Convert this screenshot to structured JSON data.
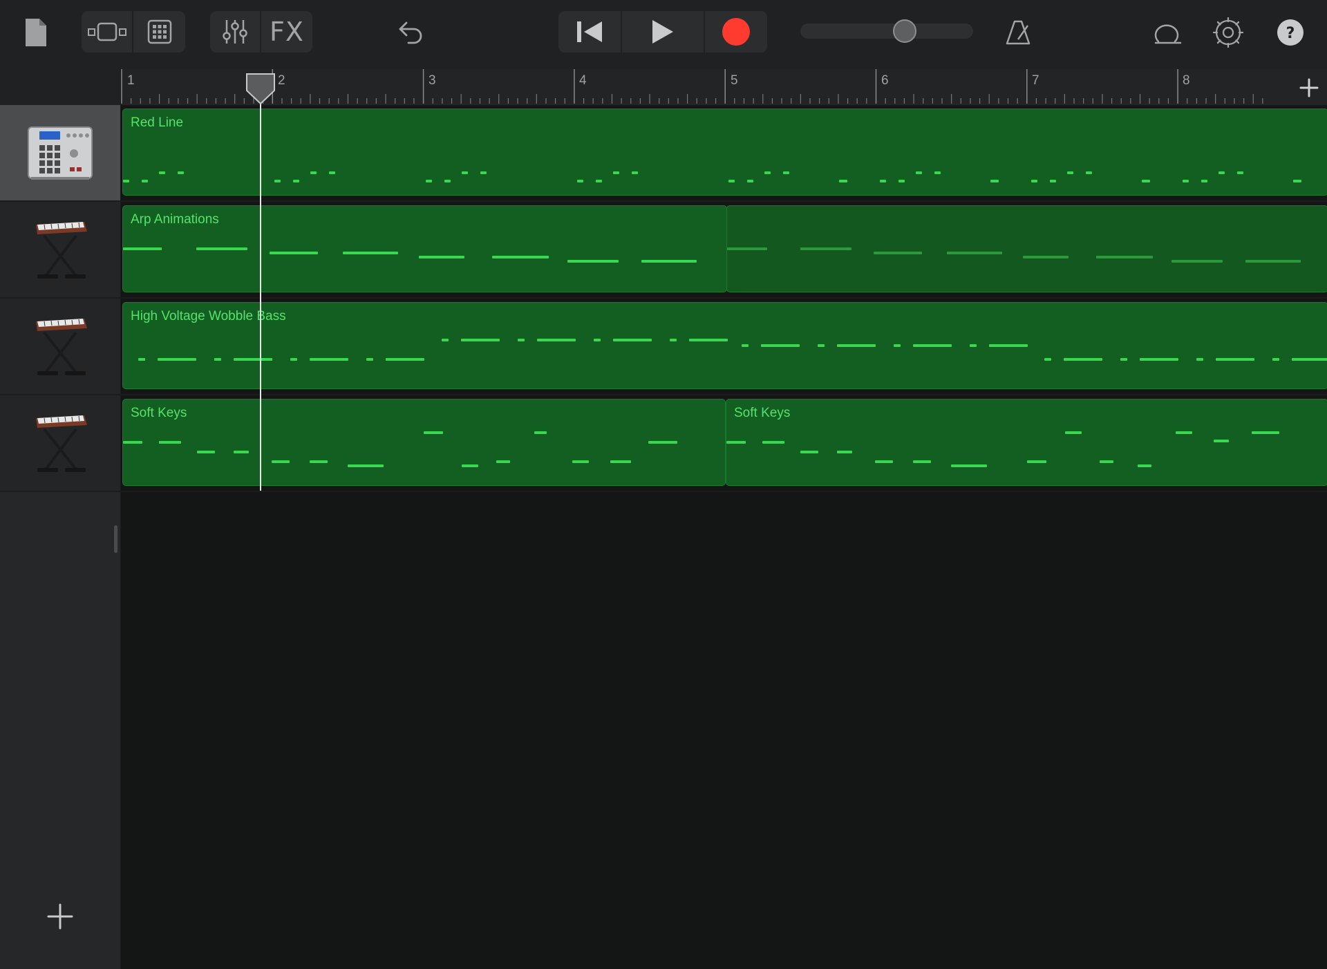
{
  "toolbar": {
    "fx_label": "FX",
    "icons": [
      "document-icon",
      "tracks-view-icon",
      "grid-icon",
      "mixer-icon",
      "undo-icon",
      "rewind-icon",
      "play-icon",
      "record-icon",
      "metronome-icon",
      "loop-icon",
      "settings-icon",
      "help-icon"
    ],
    "volume_level": 0.63,
    "accent_record": "#ff3b30"
  },
  "ruler": {
    "bars": [
      "1",
      "2",
      "3",
      "4",
      "5",
      "6",
      "7",
      "8"
    ]
  },
  "tracks": [
    {
      "name": "drum-machine",
      "instrument_icon": "drum-machine-icon",
      "selected": true,
      "regions": [
        {
          "label": "Red Line"
        }
      ]
    },
    {
      "name": "synth-arp",
      "instrument_icon": "keyboard-stand-icon",
      "selected": false,
      "regions": [
        {
          "label": "Arp Animations"
        }
      ]
    },
    {
      "name": "synth-bass",
      "instrument_icon": "keyboard-stand-icon",
      "selected": false,
      "regions": [
        {
          "label": "High Voltage Wobble Bass"
        }
      ]
    },
    {
      "name": "soft-keys",
      "instrument_icon": "keyboard-stand-icon",
      "selected": false,
      "regions": [
        {
          "label": "Soft Keys"
        },
        {
          "label": "Soft Keys"
        }
      ]
    }
  ],
  "colors": {
    "region": "#135f21",
    "note": "#38d94e",
    "label": "#55e26c",
    "background": "#141515"
  }
}
